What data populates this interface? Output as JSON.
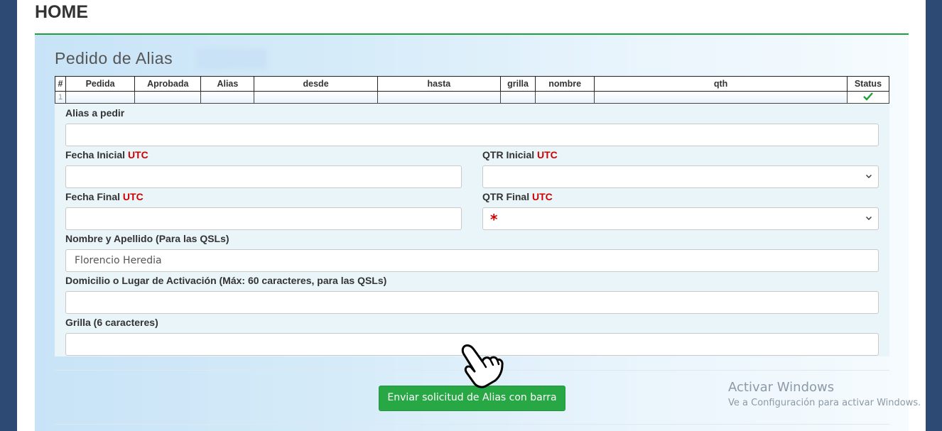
{
  "header": {
    "title": "HOME"
  },
  "panel": {
    "title": "Pedido de Alias"
  },
  "table": {
    "columns": [
      "#",
      "Pedida",
      "Aprobada",
      "Alias",
      "desde",
      "hasta",
      "grilla",
      "nombre",
      "qth",
      "Status"
    ],
    "rows": [
      {
        "num": "1",
        "status_icon": "check-icon"
      }
    ]
  },
  "form": {
    "alias_label": "Alias a pedir",
    "fecha_inicial_label": "Fecha Inicial",
    "qtr_inicial_label": "QTR Inicial",
    "fecha_final_label": "Fecha Final",
    "qtr_final_label": "QTR Final",
    "utc": "UTC",
    "qtr_final_value": "*",
    "nombre_label": "Nombre y Apellido (Para las QSLs)",
    "nombre_value": "Florencio Heredia",
    "domicilio_label": "Domicilio o Lugar de Activación (Máx: 60 caracteres, para las QSLs)",
    "grilla_label": "Grilla (6 caracteres)"
  },
  "submit": {
    "label": "Enviar solicitud de Alias con barra"
  },
  "watermark": {
    "title": "Activar Windows",
    "subtitle": "Ve a Configuración para activar Windows."
  },
  "colors": {
    "accent_green": "#28a745",
    "rule_green": "#1ea13a",
    "utc_red": "#d10000",
    "frame_blue": "#2c4a73"
  }
}
